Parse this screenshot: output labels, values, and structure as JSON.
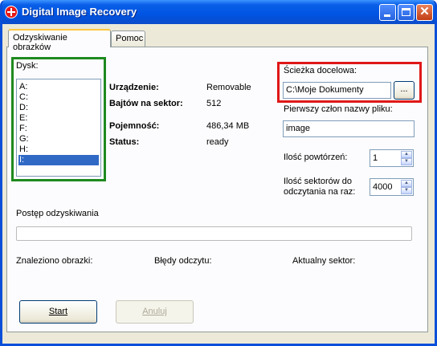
{
  "window": {
    "title": "Digital Image Recovery"
  },
  "tabs": [
    {
      "label": "Odzyskiwanie obrazków"
    },
    {
      "label": "Pomoc"
    }
  ],
  "disk": {
    "label": "Dysk:",
    "drives": [
      "A:",
      "C:",
      "D:",
      "E:",
      "F:",
      "G:",
      "H:",
      "I:"
    ],
    "selected": "I:"
  },
  "device_info": {
    "device_label": "Urządzenie:",
    "device_value": "Removable",
    "bytes_label": "Bajtów na sektor:",
    "bytes_value": "512",
    "capacity_label": "Pojemność:",
    "capacity_value": "486,34 MB",
    "status_label": "Status:",
    "status_value": "ready"
  },
  "destination": {
    "label": "Ścieżka docelowa:",
    "path": "C:\\Moje Dokumenty",
    "browse_label": "..."
  },
  "filename": {
    "label": "Pierwszy człon nazwy pliku:",
    "value": "image"
  },
  "retries": {
    "label": "Ilość powtórzeń:",
    "value": "1"
  },
  "sectors": {
    "label_line1": "Ilość sektorów do",
    "label_line2": "odczytania na raz:",
    "value": "4000"
  },
  "progress": {
    "label": "Postęp odzyskiwania",
    "fraction": 0
  },
  "stats": {
    "found_label": "Znaleziono obrazki:",
    "errors_label": "Błędy odczytu:",
    "current_label": "Aktualny sektor:"
  },
  "buttons": {
    "start": "Start",
    "cancel": "Anuluj"
  },
  "colors": {
    "highlight_disk": "#1f8a1f",
    "highlight_destination": "#e01818",
    "selection": "#316ac5"
  }
}
